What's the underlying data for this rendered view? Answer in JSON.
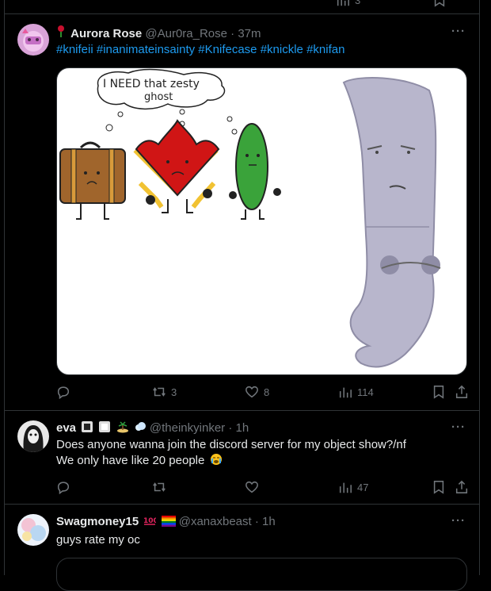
{
  "top_actions": {
    "reply_count": "",
    "retweet_count": "",
    "like_count": "",
    "views": "3"
  },
  "tweets": [
    {
      "name": "Aurora Rose",
      "handle": "@Aur0ra_Rose",
      "time": "· 37m",
      "hashtags": [
        "#knifeii",
        "#inanimateinsainty",
        "#Knifecase",
        "#knickle",
        "#knifan"
      ],
      "media": {
        "speech_line1": "I NEED that zesty",
        "speech_line2": "ghost"
      },
      "actions": {
        "retweets": "3",
        "likes": "8",
        "views": "114"
      }
    },
    {
      "name": "eva",
      "handle": "@theinkyinker",
      "time": "· 1h",
      "text_line1": "Does anyone wanna join the discord server for my object show?/nf",
      "text_line2": "We only have like 20 people",
      "actions": {
        "retweets": "",
        "likes": "",
        "views": "47"
      }
    },
    {
      "name": "Swagmoney15",
      "handle": "@xanaxbeast",
      "time": "· 1h",
      "text": "guys rate my oc"
    }
  ],
  "icons": [
    "reply-icon",
    "retweet-icon",
    "like-icon",
    "views-icon",
    "bookmark-icon",
    "share-icon",
    "more-icon",
    "rose-emoji",
    "hundred-emoji",
    "rainbow-flag-emoji",
    "crying-emoji"
  ],
  "colors": {
    "background": "#000000",
    "text": "#e7e9ea",
    "muted": "#71767b",
    "link": "#1d9bf0",
    "border": "#2f3336"
  }
}
